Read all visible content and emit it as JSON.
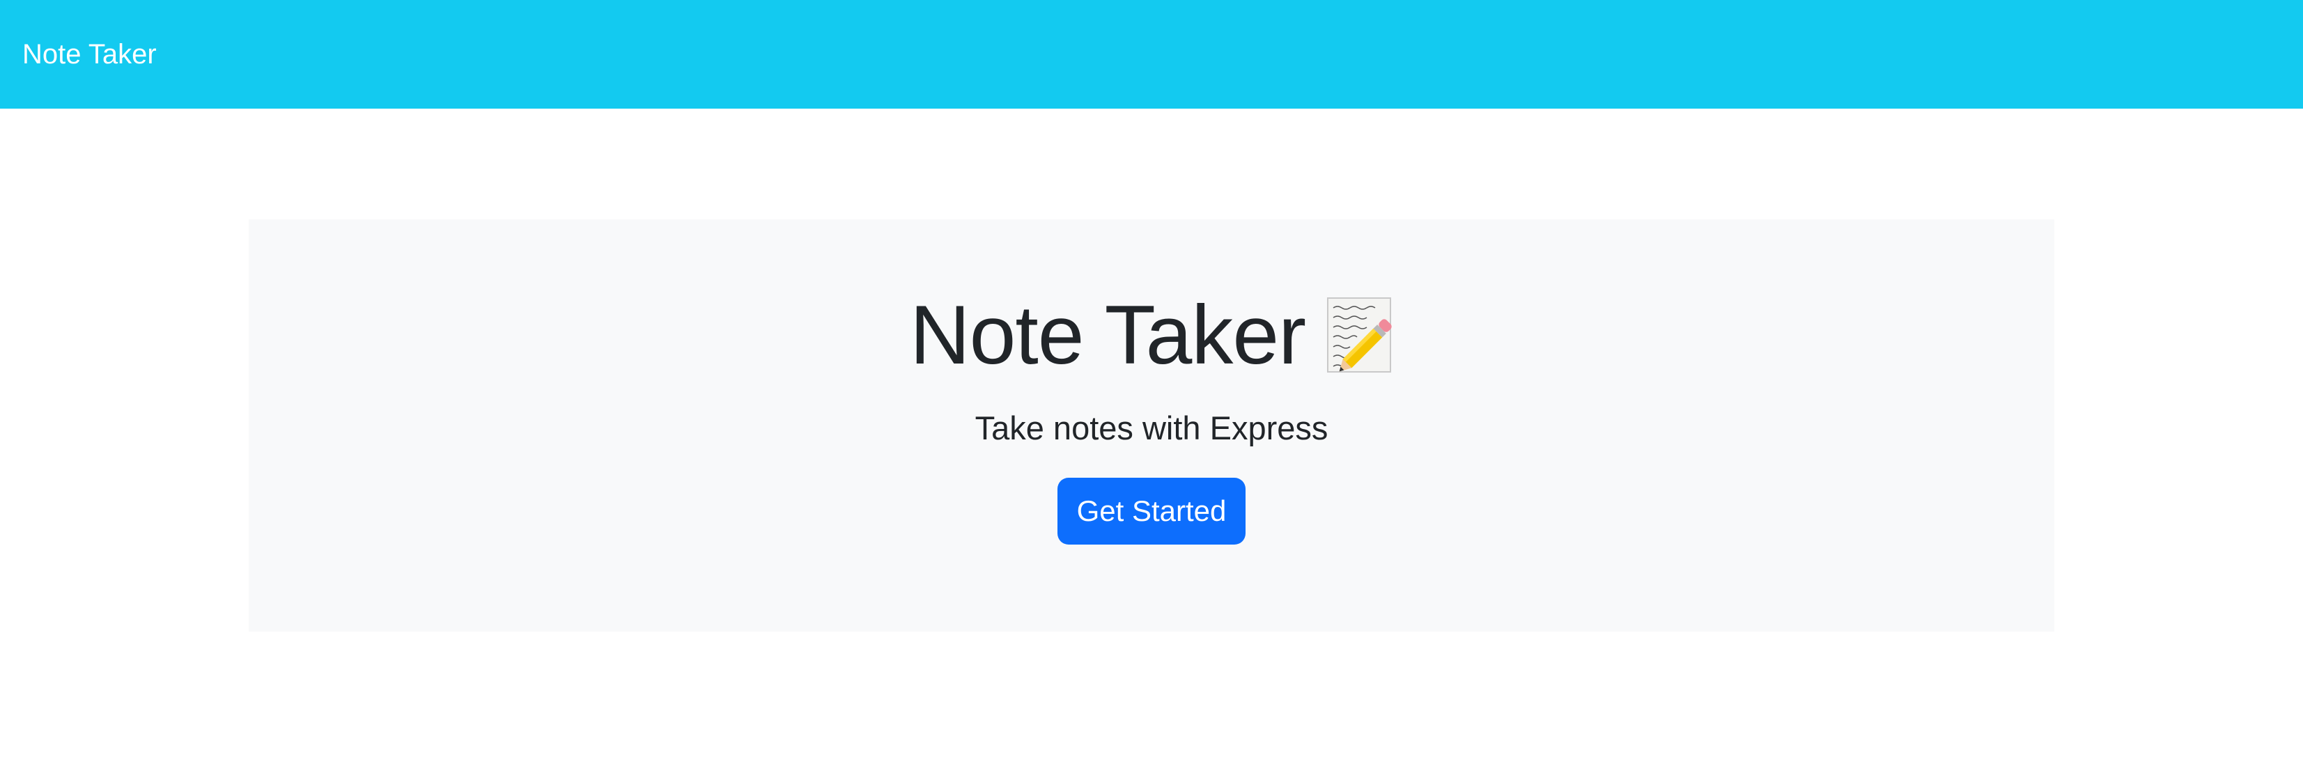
{
  "navbar": {
    "brand": "Note Taker",
    "background_color": "#13caf0"
  },
  "hero": {
    "title": "Note Taker",
    "title_icon": "memo-icon",
    "subtitle": "Take notes with Express",
    "cta_label": "Get Started",
    "cta_color": "#0d6efd",
    "background_color": "#f8f9fa"
  }
}
